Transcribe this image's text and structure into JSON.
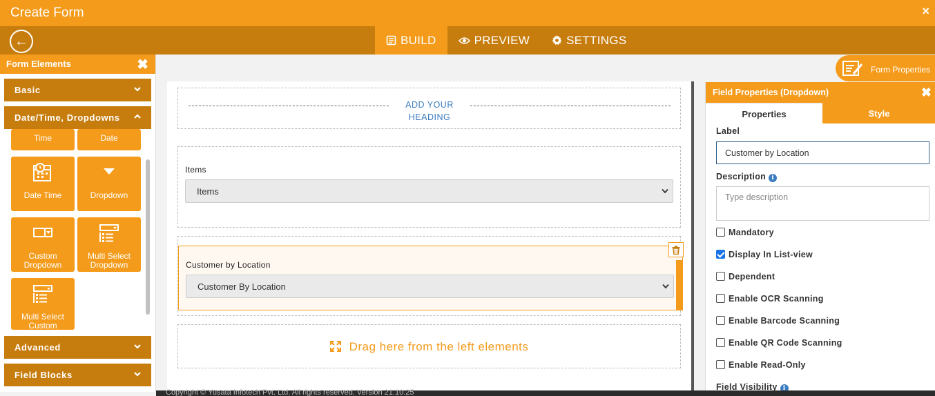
{
  "window": {
    "title": "Create Form",
    "close": "×"
  },
  "toolbar": {
    "back": "←",
    "tabs": [
      {
        "label": "BUILD",
        "icon": "form-icon",
        "active": true
      },
      {
        "label": "PREVIEW",
        "icon": "eye-icon",
        "active": false
      },
      {
        "label": "SETTINGS",
        "icon": "gear-icon",
        "active": false
      }
    ]
  },
  "left_panel": {
    "title": "Form Elements",
    "close": "✖",
    "sections": {
      "basic": "Basic",
      "datetime": "Date/Time,  Dropdowns",
      "advanced": "Advanced",
      "field_blocks": "Field  Blocks"
    },
    "tiles": {
      "time": "Time",
      "date": "Date",
      "date_time": "Date Time",
      "dropdown": "Dropdown",
      "custom_dropdown": "Custom Dropdown",
      "multi_select_dropdown": "Multi Select Dropdown",
      "multi_select_custom": "Multi Select Custom"
    }
  },
  "canvas": {
    "heading_placeholder": "ADD YOUR HEADING",
    "fields": [
      {
        "label": "Items",
        "value": "Items"
      },
      {
        "label": "Customer by Location",
        "value": "Customer By Location"
      }
    ],
    "drop_zone": "Drag here from the left elements"
  },
  "form_properties_button": "Form Properties",
  "right_panel": {
    "title": "Field Properties (Dropdown)",
    "close": "✖",
    "tabs": {
      "properties": "Properties",
      "style": "Style"
    },
    "label_caption": "Label",
    "label_value": "Customer by Location",
    "description_caption": "Description",
    "description_placeholder": "Type description",
    "options": [
      {
        "label": "Mandatory",
        "checked": false
      },
      {
        "label": "Display In List-view",
        "checked": true
      },
      {
        "label": "Dependent",
        "checked": false
      },
      {
        "label": "Enable OCR Scanning",
        "checked": false
      },
      {
        "label": "Enable Barcode Scanning",
        "checked": false
      },
      {
        "label": "Enable QR Code Scanning",
        "checked": false
      },
      {
        "label": "Enable Read-Only",
        "checked": false
      }
    ],
    "visibility_caption": "Field Visibility"
  },
  "footer": {
    "text": "Copyright © Yusata Infotech Pvt. Ltd. All rights reserved.    Version 21.10.25"
  },
  "colors": {
    "accent": "#f49b1b",
    "accent_dark": "#c77d0d",
    "link": "#3b7bbf"
  }
}
